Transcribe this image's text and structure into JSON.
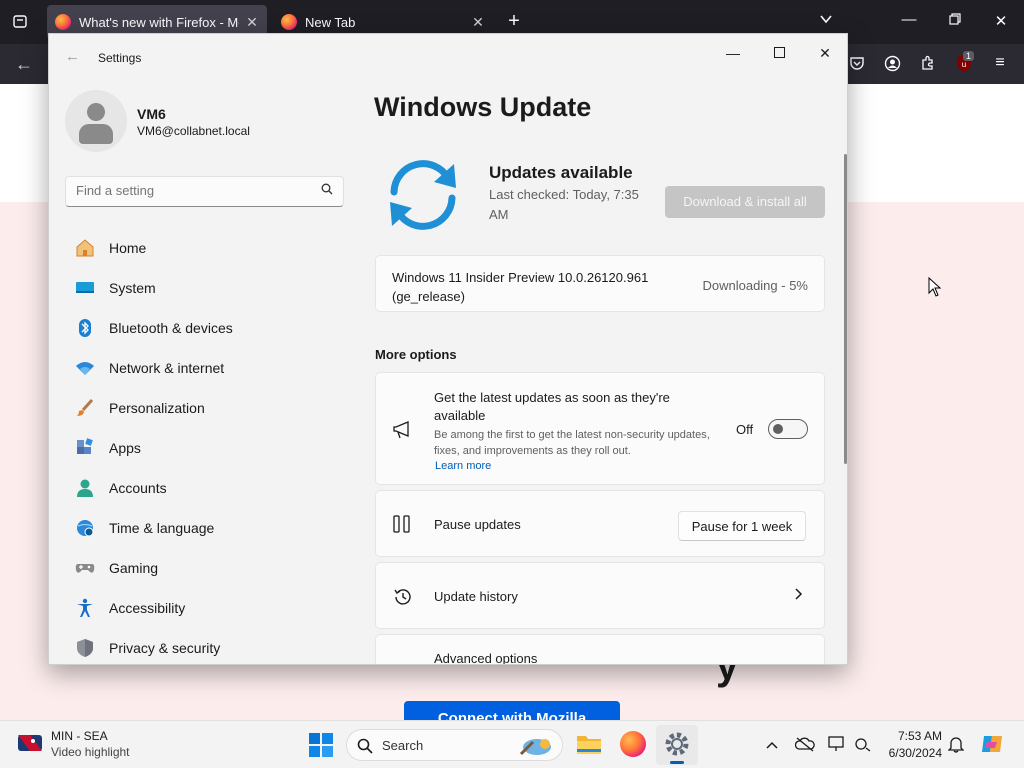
{
  "browser": {
    "tabs": [
      {
        "title": "What's new with Firefox - More"
      },
      {
        "title": "New Tab"
      }
    ],
    "notification_badge": "1"
  },
  "webpage": {
    "cta_label": "Connect with Mozilla"
  },
  "settings": {
    "app_title": "Settings",
    "profile": {
      "name": "VM6",
      "email": "VM6@collabnet.local"
    },
    "search_placeholder": "Find a setting",
    "nav": [
      {
        "label": "Home",
        "icon": "home-icon"
      },
      {
        "label": "System",
        "icon": "system-icon"
      },
      {
        "label": "Bluetooth & devices",
        "icon": "bluetooth-icon"
      },
      {
        "label": "Network & internet",
        "icon": "wifi-icon"
      },
      {
        "label": "Personalization",
        "icon": "brush-icon"
      },
      {
        "label": "Apps",
        "icon": "apps-icon"
      },
      {
        "label": "Accounts",
        "icon": "accounts-icon"
      },
      {
        "label": "Time & language",
        "icon": "globe-clock-icon"
      },
      {
        "label": "Gaming",
        "icon": "gamepad-icon"
      },
      {
        "label": "Accessibility",
        "icon": "accessibility-icon"
      },
      {
        "label": "Privacy & security",
        "icon": "shield-icon"
      }
    ],
    "main": {
      "title": "Windows Update",
      "status_heading": "Updates available",
      "last_checked": "Last checked: Today, 7:35 AM",
      "install_button": "Download & install all",
      "update": {
        "name": "Windows 11 Insider Preview 10.0.26120.961 (ge_release)",
        "status": "Downloading - 5%",
        "progress_percent": 5
      },
      "more_options_label": "More options",
      "latest": {
        "title": "Get the latest updates as soon as they're available",
        "description": "Be among the first to get the latest non-security updates, fixes, and improvements as they roll out.",
        "link": "Learn more",
        "toggle_state": "Off"
      },
      "pause": {
        "title": "Pause updates",
        "button": "Pause for 1 week"
      },
      "history": {
        "title": "Update history"
      },
      "advanced": {
        "title": "Advanced options"
      }
    }
  },
  "taskbar": {
    "weather_line1": "MIN - SEA",
    "weather_line2": "Video highlight",
    "search_label": "Search",
    "clock_time": "7:53 AM",
    "clock_date": "6/30/2024"
  },
  "colors": {
    "accent": "#005fb8",
    "sync_blue": "#1f8fd6",
    "firefox_dark": "#1f1e25"
  }
}
